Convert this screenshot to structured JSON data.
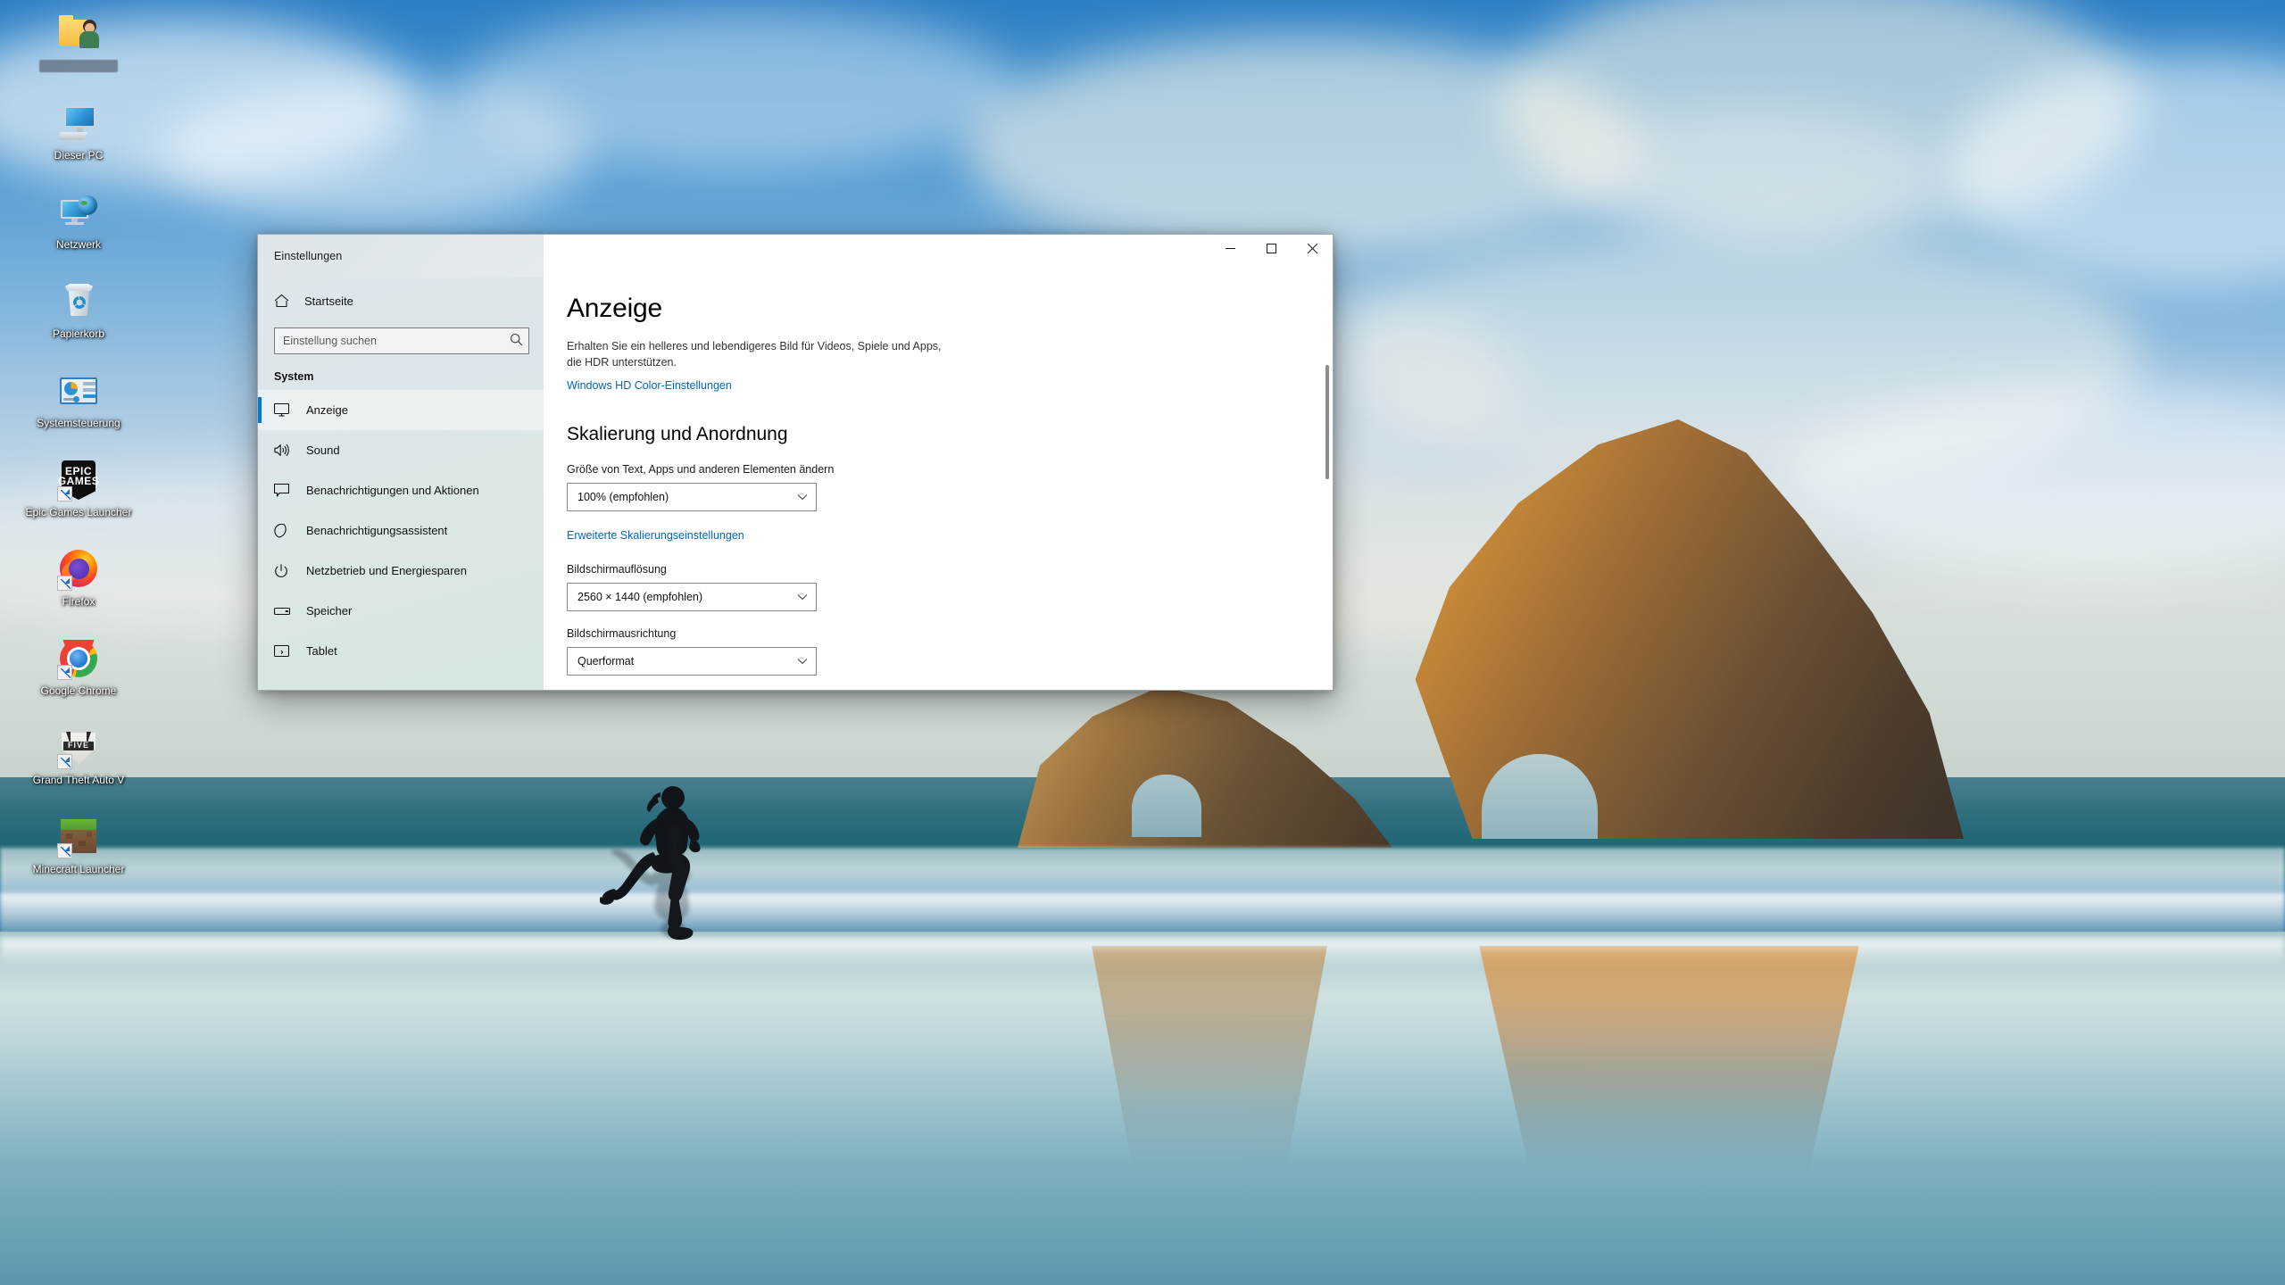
{
  "desktop": {
    "icons": [
      {
        "label": "",
        "icon": "user-folder-icon",
        "blurred": true,
        "shortcut": false
      },
      {
        "label": "Dieser PC",
        "icon": "this-pc-icon",
        "blurred": false,
        "shortcut": false
      },
      {
        "label": "Netzwerk",
        "icon": "network-icon",
        "blurred": false,
        "shortcut": false
      },
      {
        "label": "Papierkorb",
        "icon": "recycle-bin-icon",
        "blurred": false,
        "shortcut": false
      },
      {
        "label": "Systemsteuerung",
        "icon": "control-panel-icon",
        "blurred": false,
        "shortcut": false
      },
      {
        "label": "Epic Games Launcher",
        "icon": "epic-games-icon",
        "blurred": false,
        "shortcut": true
      },
      {
        "label": "Firefox",
        "icon": "firefox-icon",
        "blurred": false,
        "shortcut": true
      },
      {
        "label": "Google Chrome",
        "icon": "chrome-icon",
        "blurred": false,
        "shortcut": true
      },
      {
        "label": "Grand Theft Auto V",
        "icon": "gta-v-icon",
        "blurred": false,
        "shortcut": true
      },
      {
        "label": "Minecraft Launcher",
        "icon": "minecraft-icon",
        "blurred": false,
        "shortcut": true
      }
    ]
  },
  "window": {
    "title": "Einstellungen",
    "controls": {
      "minimize": "minimize-button",
      "maximize": "maximize-button",
      "close": "close-button"
    }
  },
  "sidebar": {
    "home_label": "Startseite",
    "search": {
      "placeholder": "Einstellung suchen",
      "value": ""
    },
    "section_title": "System",
    "items": [
      {
        "label": "Anzeige",
        "icon": "monitor-icon",
        "active": true
      },
      {
        "label": "Sound",
        "icon": "speaker-icon",
        "active": false
      },
      {
        "label": "Benachrichtigungen und Aktionen",
        "icon": "notification-icon",
        "active": false
      },
      {
        "label": "Benachrichtigungsassistent",
        "icon": "moon-icon",
        "active": false
      },
      {
        "label": "Netzbetrieb und Energiesparen",
        "icon": "power-icon",
        "active": false
      },
      {
        "label": "Speicher",
        "icon": "storage-icon",
        "active": false
      },
      {
        "label": "Tablet",
        "icon": "tablet-icon",
        "active": false
      }
    ]
  },
  "content": {
    "heading": "Anzeige",
    "hdr_description": "Erhalten Sie ein helleres und lebendigeres Bild für Videos, Spiele und Apps, die HDR unterstützen.",
    "hdr_link": "Windows HD Color-Einstellungen",
    "scaling_heading": "Skalierung und Anordnung",
    "scale_label": "Größe von Text, Apps und anderen Elementen ändern",
    "scale_value": "100% (empfohlen)",
    "advanced_scaling_link": "Erweiterte Skalierungseinstellungen",
    "resolution_label": "Bildschirmauflösung",
    "resolution_value": "2560 × 1440 (empfohlen)",
    "orientation_label": "Bildschirmausrichtung",
    "orientation_value": "Querformat"
  },
  "colors": {
    "accent": "#0078d7",
    "link": "#0067c0",
    "sidebar_bg": "#dde6ea",
    "content_bg": "#ffffff"
  }
}
